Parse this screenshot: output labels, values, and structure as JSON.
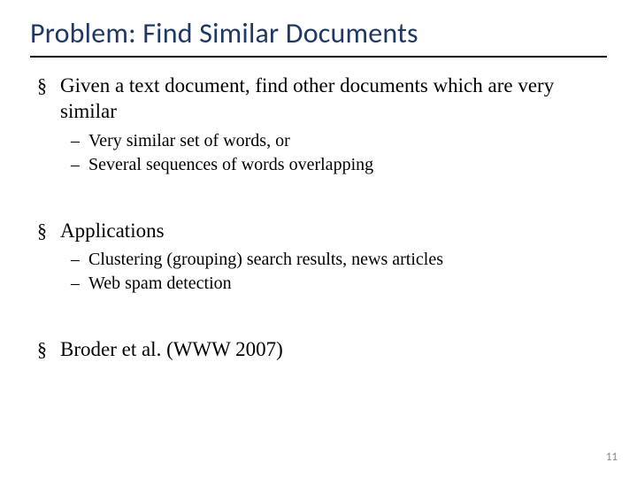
{
  "slide": {
    "title": "Problem: Find Similar Documents",
    "page_number": "11",
    "bullets": [
      {
        "text": "Given a text document, find other documents which are very similar",
        "sub": [
          "Very similar set of words, or",
          "Several sequences of words overlapping"
        ]
      },
      {
        "text": "Applications",
        "sub": [
          "Clustering (grouping) search results, news articles",
          "Web spam detection"
        ]
      },
      {
        "text": "Broder et al. (WWW 2007)",
        "sub": []
      }
    ]
  }
}
